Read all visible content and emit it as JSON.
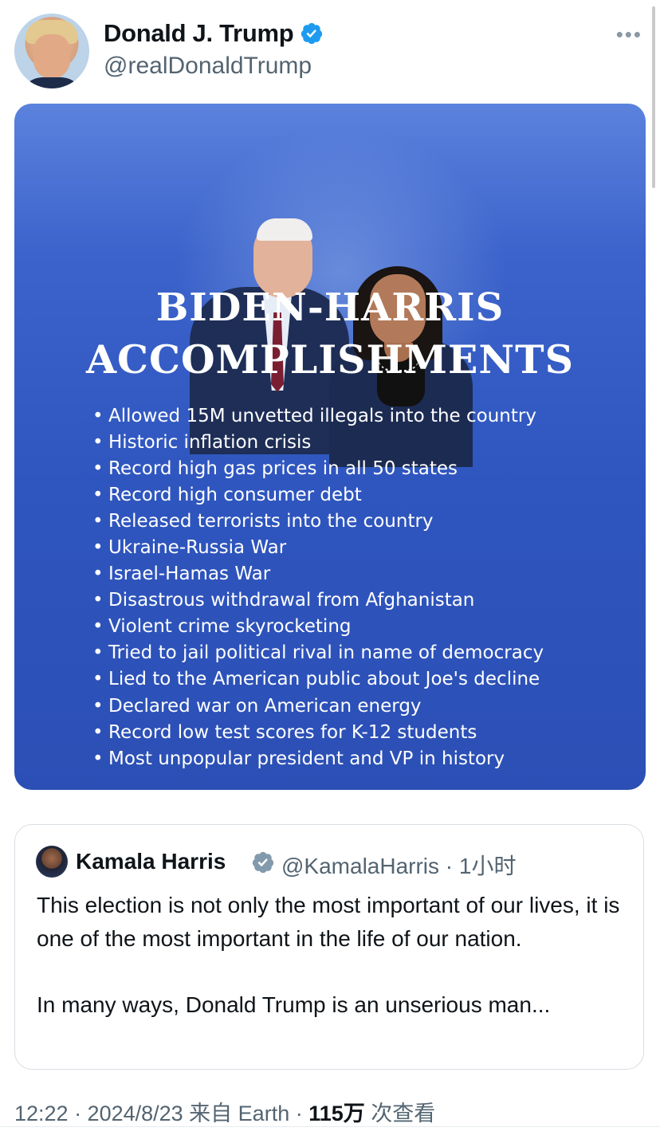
{
  "tweet": {
    "display_name": "Donald J. Trump",
    "handle": "@realDonaldTrump",
    "more": "•••",
    "verified_color": "#1d9bf0",
    "media": {
      "title_line1": "BIDEN-HARRIS",
      "title_line2": "ACCOMPLISHMENTS",
      "items": [
        "Allowed 15M unvetted illegals into the country",
        "Historic inflation crisis",
        "Record high gas prices in all 50 states",
        "Record high consumer debt",
        "Released terrorists into the country",
        "Ukraine-Russia War",
        "Israel-Hamas War",
        "Disastrous withdrawal from Afghanistan",
        "Violent crime skyrocketing",
        "Tried to jail political rival in name of democracy",
        "Lied to the American public about Joe's decline",
        "Declared war on American energy",
        "Record low test scores for K-12 students",
        "Most unpopular president and VP in history"
      ]
    }
  },
  "quote": {
    "name": "Kamala Harris",
    "handle_time": "@KamalaHarris · 1小时",
    "text_p1": "This election is not only the most important of our lives, it is one of the most important in the life of our nation.",
    "text_p2": "In many ways, Donald Trump is an unserious man..."
  },
  "meta": {
    "time": "12:22 · 2024/8/23 来自 Earth · ",
    "views_count": "115万",
    "views_label": " 次查看"
  }
}
